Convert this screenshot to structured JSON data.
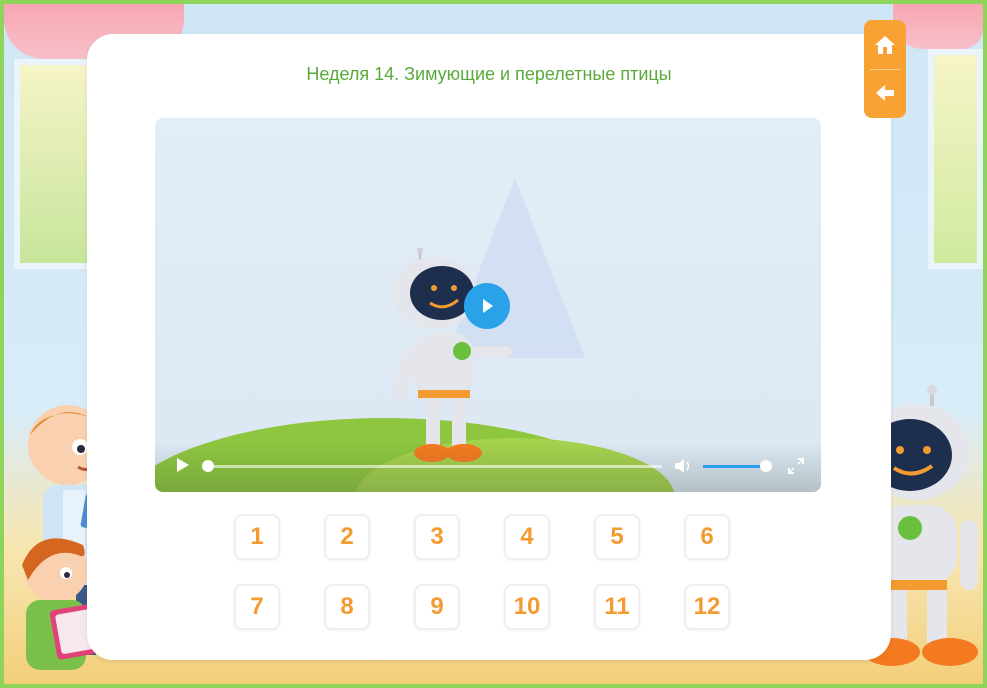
{
  "lesson": {
    "title": "Неделя 14. Зимующие и перелетные птицы"
  },
  "nav": {
    "home_icon": "home-icon",
    "back_icon": "arrow-left-icon",
    "accent": "#f8a233"
  },
  "video": {
    "play_icon": "play-icon",
    "progress": 0,
    "volume": 0.9,
    "volume_icon": "volume-icon",
    "fullscreen_icon": "fullscreen-icon"
  },
  "lessons_grid": {
    "row1": [
      "1",
      "2",
      "3",
      "4",
      "5",
      "6"
    ],
    "row2": [
      "7",
      "8",
      "9",
      "10",
      "11",
      "12"
    ],
    "color": "#f39b31"
  },
  "colors": {
    "title": "#5aa93a",
    "frame": "#8ed45a",
    "play_button": "#2aa2e9"
  }
}
